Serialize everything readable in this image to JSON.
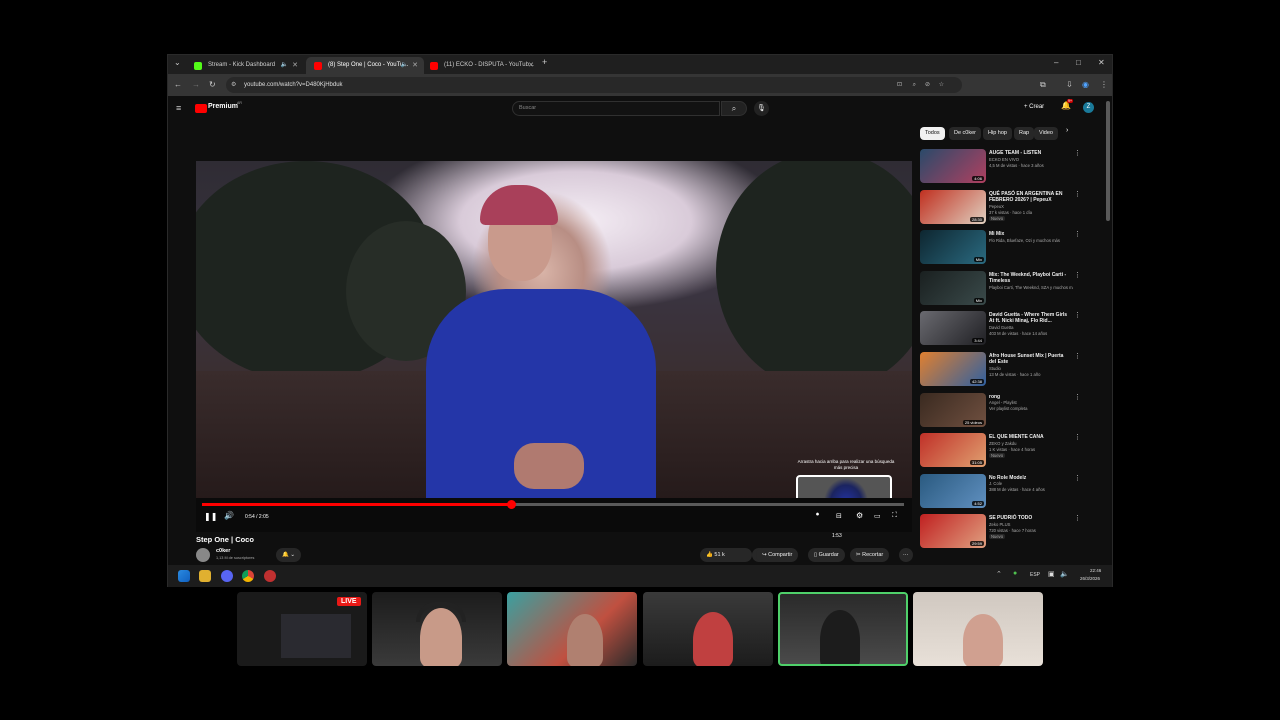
{
  "browser": {
    "tabs": [
      {
        "label": "Stream - Kick Dashboard",
        "color": "#53fc18"
      },
      {
        "label": "(8) Step One | Coco - YouTu...",
        "color": "#ff0000"
      },
      {
        "label": "(11) ECKO - DISPUTA - YouTub...",
        "color": "#ff0000"
      }
    ],
    "new_tab": "+",
    "url": "youtube.com/watch?v=D480KjHbduk",
    "window_controls": [
      "–",
      "□",
      "✕"
    ]
  },
  "youtube": {
    "logo": "Premium",
    "logo_badge": "AR",
    "search_placeholder": "Buscar",
    "create_label": "+ Crear",
    "notif_badge": "9+",
    "avatar_letter": "Z"
  },
  "player": {
    "current_time": "0:54 / 2:05",
    "progress_fraction": 0.44,
    "preview_time": "1:53",
    "preview_hint": "Arrastra hacia arriba para realizar una búsqueda más precisa",
    "title": "Step One | Coco",
    "channel_name": "c0ker",
    "channel_subs": "1,13 M de suscriptores",
    "likes": "51 k",
    "share_label": "Compartir",
    "save_label": "Guardar",
    "clip_label": "Recortar"
  },
  "chips": [
    "Todos",
    "De c0ker",
    "Hip hop",
    "Rap",
    "Video"
  ],
  "recommendations": [
    {
      "title": "AUGE TEAM - LISTEN",
      "line1": "ECKO EN VIVO",
      "line2": "4,5 M de vistas · hace 3 años",
      "dur": "4:06",
      "c1": "#2a4a6a",
      "c2": "#b04060"
    },
    {
      "title": "QUÉ PASÓ EN ARGENTINA EN FEBRERO 2026? | PepeuX",
      "line1": "PepeuX",
      "line2": "37 k vistas · hace 1 día",
      "badge": "Nuevo",
      "dur": "28:30",
      "c1": "#c03020",
      "c2": "#e0d0c0"
    },
    {
      "title": "Mi Mix",
      "line1": "Flo Rida, Bluefaze, Ozi y muchos más",
      "line2": "",
      "dur": "Mix",
      "c1": "#0e2630",
      "c2": "#2a6a80"
    },
    {
      "title": "Mix: The Weeknd, Playboi Carti - Timeless",
      "line1": "Playboi Carti, The Weeknd, SZA y muchos más",
      "line2": "",
      "dur": "Mix",
      "c1": "#1a2020",
      "c2": "#3a4a4a"
    },
    {
      "title": "David Guetta - Where Them Girls At ft. Nicki Minaj, Flo Rid...",
      "line1": "David Guetta",
      "line2": "403 M de vistas · hace 14 años",
      "dur": "3:44",
      "c1": "#6a6a70",
      "c2": "#202024"
    },
    {
      "title": "Afro House Sunset Mix | Puerta del Este",
      "line1": "Studio",
      "line2": "13 M de vistas · hace 1 año",
      "dur": "42:38",
      "c1": "#e08030",
      "c2": "#3060a0"
    },
    {
      "title": "rong",
      "line1": "Angel - Playlist",
      "line2": "Ver playlist completa",
      "dur": "25 videos",
      "c1": "#3a2a20",
      "c2": "#705040"
    },
    {
      "title": "EL QUE MIENTE CANA",
      "line1": "ZEKO y Zakdu",
      "line2": "1 K vistas · hace 4 horas",
      "badge": "Nuevo",
      "dur": "31:05",
      "c1": "#c03028",
      "c2": "#e0a070"
    },
    {
      "title": "No Role Modelz",
      "line1": "J. Cole",
      "line2": "388 M de vistas · hace 4 años",
      "dur": "4:52",
      "c1": "#2a5a80",
      "c2": "#6090c0"
    },
    {
      "title": "SE PUDRIÓ TODO",
      "line1": "Zeko PLUS",
      "line2": "720 vistas · hace 7 horas",
      "badge": "Nuevo",
      "dur": "29:59",
      "c1": "#c02020",
      "c2": "#e0a080"
    }
  ],
  "taskbar": {
    "lang": "ESP",
    "time": "22:46",
    "date": "26/3/2026"
  },
  "stream": {
    "live_label": "LIVE"
  }
}
